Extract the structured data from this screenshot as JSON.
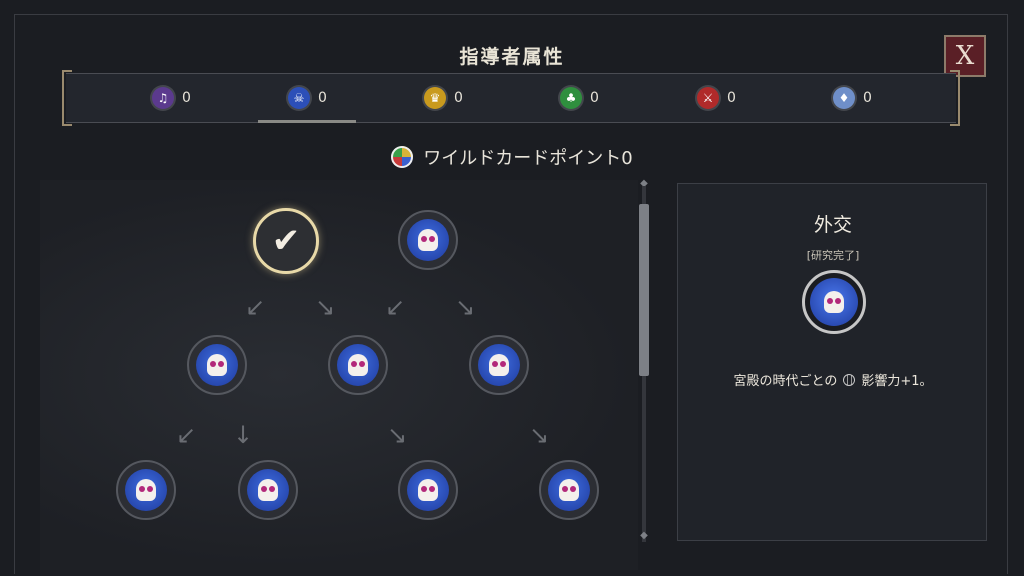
{
  "title": "指導者属性",
  "close_label": "X",
  "attributes": [
    {
      "icon": "music-note-icon",
      "color": "#5b3a8e",
      "value": "0"
    },
    {
      "icon": "skull-icon",
      "color": "#2c4fb8",
      "value": "0"
    },
    {
      "icon": "crown-icon",
      "color": "#c99a1e",
      "value": "0"
    },
    {
      "icon": "science-icon",
      "color": "#2f8f3e",
      "value": "0"
    },
    {
      "icon": "military-icon",
      "color": "#b02a2a",
      "value": "0"
    },
    {
      "icon": "faith-icon",
      "color": "#6f8fc9",
      "value": "0"
    }
  ],
  "wildcard": {
    "label": "ワイルドカードポイント0"
  },
  "panel": {
    "title": "外交",
    "status": "[研究完了]",
    "description_prefix": "宮殿の時代ごとの",
    "description_suffix": "影響力+1。"
  }
}
